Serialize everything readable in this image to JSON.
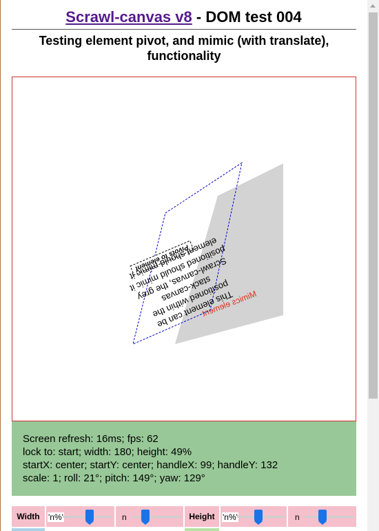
{
  "header": {
    "title_link": "Scrawl-canvas v8",
    "title_rest": " - DOM test 004",
    "subtitle_line1": "Testing element pivot, and mimic (with translate),",
    "subtitle_line2": "functionality"
  },
  "canvas": {
    "pivot_label": "Pivots to element",
    "body_lines": [
      "This element can be",
      "positioned within the",
      "stack-canvas",
      "Scrawl-canvas, the grey",
      "positioned should mimic it",
      "element should mimic it"
    ],
    "mimic_label": "Mimics element",
    "colors": {
      "border": "#d0312d",
      "mimic_fill": "#d3d3d3",
      "mimic_text": "#e0301e",
      "outline": "#0000cc"
    }
  },
  "status": {
    "line1": "Screen refresh: 16ms; fps: 62",
    "line2": "lock to: start; width: 180; height: 49%",
    "line3": "startX: center; startY: center; handleX: 99; handleY: 132",
    "line4": "scale: 1; roll: 21°; pitch: 149°; yaw: 129°",
    "bg": "#98c897"
  },
  "controls": {
    "width_label": "Width",
    "width_unit_1": "'n%'",
    "width_unit_2": "n",
    "height_label": "Height",
    "height_unit_1": "'n%'",
    "height_unit_2": "n",
    "bg": "#f5c0cb",
    "accent": "#1a73e8"
  }
}
